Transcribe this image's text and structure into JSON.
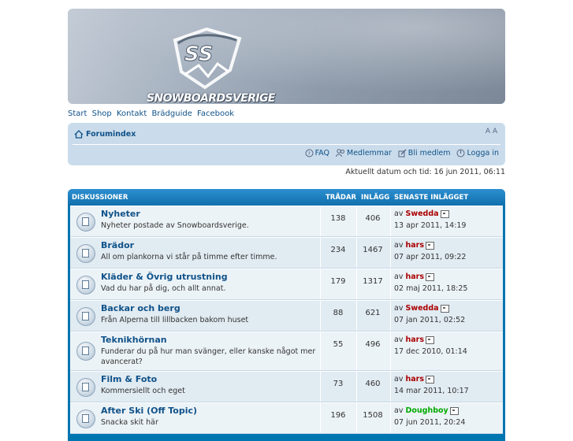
{
  "banner": {
    "logo_text": "SNOWBOARDSVERIGE"
  },
  "topnav": [
    "Start",
    "Shop",
    "Kontakt",
    "Brädguide",
    "Facebook"
  ],
  "navbar": {
    "home_label": "Forumindex",
    "resize_label": "A A",
    "links": [
      {
        "label": "FAQ",
        "icon": "faq-icon"
      },
      {
        "label": "Medlemmar",
        "icon": "members-icon"
      },
      {
        "label": "Bli medlem",
        "icon": "register-icon"
      },
      {
        "label": "Logga in",
        "icon": "login-icon"
      }
    ]
  },
  "datetime": "Aktuellt datum och tid: 16 jun 2011, 06:11",
  "forum": {
    "headers": {
      "discussions": "DISKUSSIONER",
      "threads": "TRÅDAR",
      "posts": "INLÄGG",
      "last": "SENASTE INLÄGGET"
    },
    "rows": [
      {
        "title": "Nyheter",
        "desc": "Nyheter postade av Snowboardsverige.",
        "threads": "138",
        "posts": "406",
        "by": "av",
        "user": "Swedda",
        "user_color": "#AA0000",
        "date": "13 apr 2011, 14:19"
      },
      {
        "title": "Brädor",
        "desc": "All om plankorna vi står på timme efter timme.",
        "threads": "234",
        "posts": "1467",
        "by": "av",
        "user": "hars",
        "user_color": "#AA0000",
        "date": "07 apr 2011, 09:22"
      },
      {
        "title": "Kläder & Övrig utrustning",
        "desc": "Vad du har på dig, och allt annat.",
        "threads": "179",
        "posts": "1317",
        "by": "av",
        "user": "hars",
        "user_color": "#AA0000",
        "date": "02 maj 2011, 18:25"
      },
      {
        "title": "Backar och berg",
        "desc": "Från Alperna till lillbacken bakom huset",
        "threads": "88",
        "posts": "621",
        "by": "av",
        "user": "Swedda",
        "user_color": "#AA0000",
        "date": "07 jan 2011, 02:52"
      },
      {
        "title": "Teknikhörnan",
        "desc": "Funderar du på hur man svänger, eller kanske något mer avancerat?",
        "threads": "55",
        "posts": "496",
        "by": "av",
        "user": "hars",
        "user_color": "#AA0000",
        "date": "17 dec 2010, 01:14"
      },
      {
        "title": "Film & Foto",
        "desc": "Kommersiellt och eget",
        "threads": "73",
        "posts": "460",
        "by": "av",
        "user": "hars",
        "user_color": "#AA0000",
        "date": "14 mar 2011, 10:17"
      },
      {
        "title": "After Ski (Off Topic)",
        "desc": "Snacka skit här",
        "threads": "196",
        "posts": "1508",
        "by": "av",
        "user": "Doughboy",
        "user_color": "#00AA00",
        "date": "07 jun 2011, 20:24"
      }
    ]
  }
}
